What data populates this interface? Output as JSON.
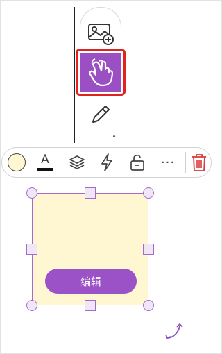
{
  "side_tools": {
    "items": [
      {
        "icon": "image-add-icon",
        "active": false
      },
      {
        "icon": "hand-pointer-icon",
        "active": true
      },
      {
        "icon": "pencil-icon",
        "active": false
      }
    ],
    "active_color": "#9a4fc2",
    "highlight_color": "#e0231e"
  },
  "toolbar": {
    "items": [
      {
        "icon": "fill-color-swatch",
        "color": "#fff6d2"
      },
      {
        "icon": "text-color-icon",
        "letter": "A",
        "color": "#111111"
      },
      {
        "icon": "layers-icon"
      },
      {
        "icon": "lightning-icon"
      },
      {
        "icon": "unlock-icon"
      },
      {
        "icon": "more-icon",
        "text": "···"
      },
      {
        "icon": "trash-icon",
        "color": "#d93a3a"
      }
    ]
  },
  "sticky_note": {
    "background": "#fff6d2",
    "border_color": "#a56ad0",
    "edit_button_label": "编辑",
    "edit_button_color": "#9b52c6"
  },
  "rotate": {
    "icon": "rotate-icon",
    "color": "#8a4fbf"
  }
}
